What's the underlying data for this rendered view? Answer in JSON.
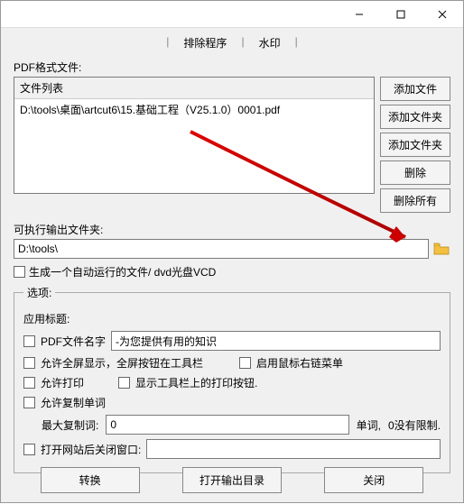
{
  "tabs": {
    "exclude": "排除程序",
    "watermark": "水印"
  },
  "labels": {
    "pdf_files": "PDF格式文件:",
    "file_list_header": "文件列表",
    "output_folder": "可执行输出文件夹:",
    "options_legend": "选项:",
    "app_title": "应用标题:",
    "pdf_filename": "PDF文件名字",
    "max_copy": "最大复制词:",
    "word_unit": "单词,",
    "no_limit": "0没有限制."
  },
  "files": {
    "row1": "D:\\tools\\桌面\\artcut6\\15.基础工程（V25.1.0）0001.pdf"
  },
  "output_path": "D:\\tools\\",
  "side_buttons": {
    "add_file": "添加文件",
    "add_folder1": "添加文件夹",
    "add_folder2": "添加文件夹",
    "delete": "删除",
    "delete_all": "删除所有"
  },
  "checkboxes": {
    "autorun": "生成一个自动运行的文件/ dvd光盘VCD",
    "pdf_name_value": "-为您提供有用的知识",
    "fullscreen": "允许全屏显示，全屏按钮在工具栏",
    "rightclick": "启用鼠标右链菜单",
    "allow_print": "允许打印",
    "show_print_btn": "显示工具栏上的打印按钮.",
    "allow_copy": "允许复制单词",
    "max_copy_value": "0",
    "close_window": "打开网站后关闭窗口:"
  },
  "bottom": {
    "convert": "转换",
    "open_output": "打开输出目录",
    "close": "关闭"
  }
}
